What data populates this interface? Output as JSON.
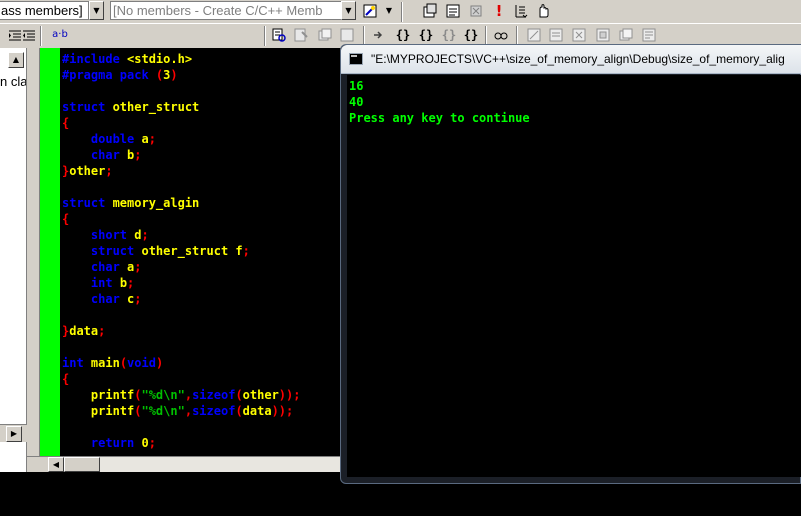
{
  "toolbar": {
    "class_combo": "ass members]",
    "members_combo": "[No members - Create C/C++ Memb",
    "combo_arrow": "▼",
    "wizard_arrow": "▼",
    "row2_left_label": "a·b",
    "icons_row1": [
      "class-wizard-icon",
      "compile-icon",
      "build-icon",
      "stop-build-icon",
      "execute-icon",
      "go-icon",
      "breakpoint-icon"
    ],
    "icons_row2": [
      "find-in-files-icon",
      "watch-icon",
      "call-stack-icon",
      "step-into-icon",
      "step-over-icon",
      "step-out-icon",
      "run-to-cursor-icon",
      "quickwatch-icon"
    ]
  },
  "left_panel": {
    "label": "n cla",
    "scroll_up": "▲",
    "scroll_down": "▼",
    "scroll_right": "▶"
  },
  "editor": {
    "scroll_left": "◀",
    "lines": [
      {
        "parts": [
          {
            "t": "#include ",
            "c": "pp"
          },
          {
            "t": "<stdio.h>",
            "c": "n"
          }
        ]
      },
      {
        "parts": [
          {
            "t": "#pragma pack ",
            "c": "pp"
          },
          {
            "t": "(",
            "c": "r"
          },
          {
            "t": "3",
            "c": "n"
          },
          {
            "t": ")",
            "c": "r"
          }
        ]
      },
      {
        "parts": []
      },
      {
        "parts": [
          {
            "t": "struct ",
            "c": "k"
          },
          {
            "t": "other_struct",
            "c": "n"
          }
        ]
      },
      {
        "parts": [
          {
            "t": "{",
            "c": "r"
          }
        ]
      },
      {
        "parts": [
          {
            "t": "    ",
            "c": "n"
          },
          {
            "t": "double ",
            "c": "k"
          },
          {
            "t": "a",
            "c": "n"
          },
          {
            "t": ";",
            "c": "r"
          }
        ]
      },
      {
        "parts": [
          {
            "t": "    ",
            "c": "n"
          },
          {
            "t": "char ",
            "c": "k"
          },
          {
            "t": "b",
            "c": "n"
          },
          {
            "t": ";",
            "c": "r"
          }
        ]
      },
      {
        "parts": [
          {
            "t": "}",
            "c": "r"
          },
          {
            "t": "other",
            "c": "n"
          },
          {
            "t": ";",
            "c": "r"
          }
        ]
      },
      {
        "parts": []
      },
      {
        "parts": [
          {
            "t": "struct ",
            "c": "k"
          },
          {
            "t": "memory_algin",
            "c": "n"
          }
        ]
      },
      {
        "parts": [
          {
            "t": "{",
            "c": "r"
          }
        ]
      },
      {
        "parts": [
          {
            "t": "    ",
            "c": "n"
          },
          {
            "t": "short ",
            "c": "k"
          },
          {
            "t": "d",
            "c": "n"
          },
          {
            "t": ";",
            "c": "r"
          }
        ]
      },
      {
        "parts": [
          {
            "t": "    ",
            "c": "n"
          },
          {
            "t": "struct ",
            "c": "k"
          },
          {
            "t": "other_struct f",
            "c": "n"
          },
          {
            "t": ";",
            "c": "r"
          }
        ]
      },
      {
        "parts": [
          {
            "t": "    ",
            "c": "n"
          },
          {
            "t": "char ",
            "c": "k"
          },
          {
            "t": "a",
            "c": "n"
          },
          {
            "t": ";",
            "c": "r"
          }
        ]
      },
      {
        "parts": [
          {
            "t": "    ",
            "c": "n"
          },
          {
            "t": "int ",
            "c": "k"
          },
          {
            "t": "b",
            "c": "n"
          },
          {
            "t": ";",
            "c": "r"
          }
        ]
      },
      {
        "parts": [
          {
            "t": "    ",
            "c": "n"
          },
          {
            "t": "char ",
            "c": "k"
          },
          {
            "t": "c",
            "c": "n"
          },
          {
            "t": ";",
            "c": "r"
          }
        ]
      },
      {
        "parts": []
      },
      {
        "parts": [
          {
            "t": "}",
            "c": "r"
          },
          {
            "t": "data",
            "c": "n"
          },
          {
            "t": ";",
            "c": "r"
          }
        ]
      },
      {
        "parts": []
      },
      {
        "parts": [
          {
            "t": "int ",
            "c": "k"
          },
          {
            "t": "main",
            "c": "n"
          },
          {
            "t": "(",
            "c": "r"
          },
          {
            "t": "void",
            "c": "k"
          },
          {
            "t": ")",
            "c": "r"
          }
        ]
      },
      {
        "parts": [
          {
            "t": "{",
            "c": "r"
          }
        ]
      },
      {
        "parts": [
          {
            "t": "    printf",
            "c": "n"
          },
          {
            "t": "(",
            "c": "r"
          },
          {
            "t": "\"%d\\n\"",
            "c": "s"
          },
          {
            "t": ",",
            "c": "r"
          },
          {
            "t": "sizeof",
            "c": "k"
          },
          {
            "t": "(",
            "c": "r"
          },
          {
            "t": "other",
            "c": "n"
          },
          {
            "t": "));",
            "c": "r"
          }
        ]
      },
      {
        "parts": [
          {
            "t": "    printf",
            "c": "n"
          },
          {
            "t": "(",
            "c": "r"
          },
          {
            "t": "\"%d\\n\"",
            "c": "s"
          },
          {
            "t": ",",
            "c": "r"
          },
          {
            "t": "sizeof",
            "c": "k"
          },
          {
            "t": "(",
            "c": "r"
          },
          {
            "t": "data",
            "c": "n"
          },
          {
            "t": "));",
            "c": "r"
          }
        ]
      },
      {
        "parts": []
      },
      {
        "parts": [
          {
            "t": "    ",
            "c": "n"
          },
          {
            "t": "return ",
            "c": "k"
          },
          {
            "t": "0",
            "c": "n"
          },
          {
            "t": ";",
            "c": "r"
          }
        ]
      }
    ]
  },
  "console": {
    "title": "\"E:\\MYPROJECTS\\VC++\\size_of_memory_align\\Debug\\size_of_memory_alig",
    "output": [
      "16",
      "40",
      "Press any key to continue"
    ]
  }
}
